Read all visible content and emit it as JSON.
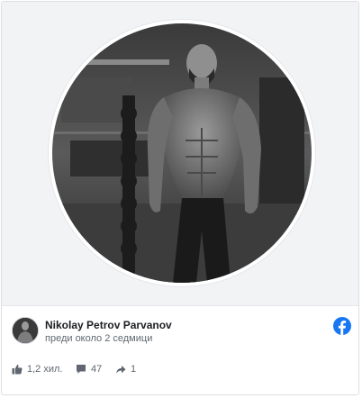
{
  "post": {
    "author": "Nikolay Petrov Parvanov",
    "time": "преди около 2 седмици"
  },
  "stats": {
    "likes": "1,2 хил.",
    "comments": "47",
    "shares": "1"
  },
  "colors": {
    "facebook_blue": "#1877f2",
    "meta_text": "#606770",
    "name_text": "#1c1e21"
  },
  "icons": {
    "like": "thumbs-up-icon",
    "comment": "comment-bubble-icon",
    "share": "share-arrow-icon",
    "brand": "facebook-icon"
  }
}
